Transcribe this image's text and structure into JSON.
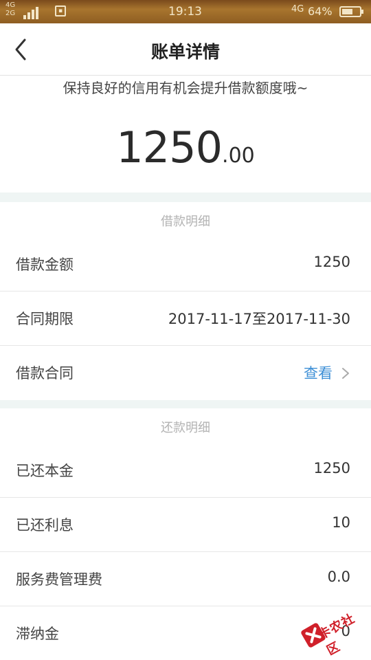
{
  "status_bar": {
    "left_net_top": "4G",
    "left_net_bottom": "2G",
    "time": "19:13",
    "right_net": "4G",
    "battery": "64%",
    "battery_level": 0.64
  },
  "header": {
    "title": "账单详情",
    "back_icon": "back-chevron-icon"
  },
  "summary": {
    "tip": "保持良好的信用有机会提升借款额度哦~",
    "amount_int": "1250",
    "amount_dec": ".00"
  },
  "loan_details": {
    "section_title": "借款明细",
    "rows": [
      {
        "label": "借款金额",
        "value": "1250"
      },
      {
        "label": "合同期限",
        "value": "2017-11-17至2017-11-30"
      },
      {
        "label": "借款合同",
        "link": "查看"
      }
    ]
  },
  "repay_details": {
    "section_title": "还款明细",
    "rows": [
      {
        "label": "已还本金",
        "value": "1250"
      },
      {
        "label": "已还利息",
        "value": "10"
      },
      {
        "label": "服务费管理费",
        "value": "0.0"
      },
      {
        "label": "滞纳金",
        "value": "0"
      }
    ]
  },
  "watermark": {
    "text": "卡农社区"
  },
  "colors": {
    "link": "#3d8fd6",
    "divider_band": "#eff5f4",
    "watermark": "#d0202a"
  }
}
